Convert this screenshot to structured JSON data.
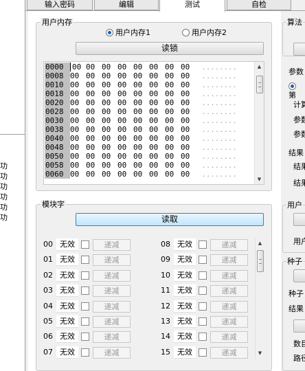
{
  "left_strip": {
    "items": [
      "功",
      "功",
      "功",
      "功",
      "功",
      "功"
    ]
  },
  "tabs": [
    {
      "label": "输入密码"
    },
    {
      "label": "编辑"
    },
    {
      "label": "测试"
    },
    {
      "label": "自检"
    }
  ],
  "user_memory": {
    "title": "用户内存",
    "radio1": "用户内存1",
    "radio2": "用户内存2",
    "read_button": "读锁",
    "rows": [
      {
        "addr": "0000",
        "bytes": [
          "00",
          "00",
          "00",
          "00",
          "00",
          "00",
          "00",
          "00"
        ],
        "ascii": "........"
      },
      {
        "addr": "0008",
        "bytes": [
          "00",
          "00",
          "00",
          "00",
          "00",
          "00",
          "00",
          "00"
        ],
        "ascii": "........"
      },
      {
        "addr": "0010",
        "bytes": [
          "00",
          "00",
          "00",
          "00",
          "00",
          "00",
          "00",
          "00"
        ],
        "ascii": "........"
      },
      {
        "addr": "0018",
        "bytes": [
          "00",
          "00",
          "00",
          "00",
          "00",
          "00",
          "00",
          "00"
        ],
        "ascii": "........"
      },
      {
        "addr": "0020",
        "bytes": [
          "00",
          "00",
          "00",
          "00",
          "00",
          "00",
          "00",
          "00"
        ],
        "ascii": "........"
      },
      {
        "addr": "0028",
        "bytes": [
          "00",
          "00",
          "00",
          "00",
          "00",
          "00",
          "00",
          "00"
        ],
        "ascii": "........"
      },
      {
        "addr": "0030",
        "bytes": [
          "00",
          "00",
          "00",
          "00",
          "00",
          "00",
          "00",
          "00"
        ],
        "ascii": "........"
      },
      {
        "addr": "0038",
        "bytes": [
          "00",
          "00",
          "00",
          "00",
          "00",
          "00",
          "00",
          "00"
        ],
        "ascii": "........"
      },
      {
        "addr": "0040",
        "bytes": [
          "00",
          "00",
          "00",
          "00",
          "00",
          "00",
          "00",
          "00"
        ],
        "ascii": "........"
      },
      {
        "addr": "0048",
        "bytes": [
          "00",
          "00",
          "00",
          "00",
          "00",
          "00",
          "00",
          "00"
        ],
        "ascii": "........"
      },
      {
        "addr": "0050",
        "bytes": [
          "00",
          "00",
          "00",
          "00",
          "00",
          "00",
          "00",
          "00"
        ],
        "ascii": "........"
      },
      {
        "addr": "0058",
        "bytes": [
          "00",
          "00",
          "00",
          "00",
          "00",
          "00",
          "00",
          "00"
        ],
        "ascii": "........"
      },
      {
        "addr": "0060",
        "bytes": [
          "00",
          "00",
          "00",
          "00",
          "00",
          "00",
          "00",
          "00"
        ],
        "ascii": "........"
      }
    ]
  },
  "module_word": {
    "title": "模块字",
    "read_button": "读取",
    "invalid_label": "无效",
    "decrement_label": "递减",
    "left_numbers": [
      "00",
      "01",
      "02",
      "03",
      "04",
      "05",
      "06",
      "07"
    ],
    "right_numbers": [
      "08",
      "09",
      "10",
      "11",
      "12",
      "13",
      "14",
      "15"
    ]
  },
  "right_panel": {
    "algo": "算法",
    "param": "参数",
    "radio_partial": "第",
    "calc": "计算",
    "param1": "参数",
    "param2": "参数",
    "result1": "结果",
    "result2": "结果",
    "result3": "结果",
    "user": "用户",
    "user2": "用户",
    "seed": "种子",
    "seed2": "种子",
    "result4": "结果",
    "count": "数目",
    "path": "路径"
  }
}
